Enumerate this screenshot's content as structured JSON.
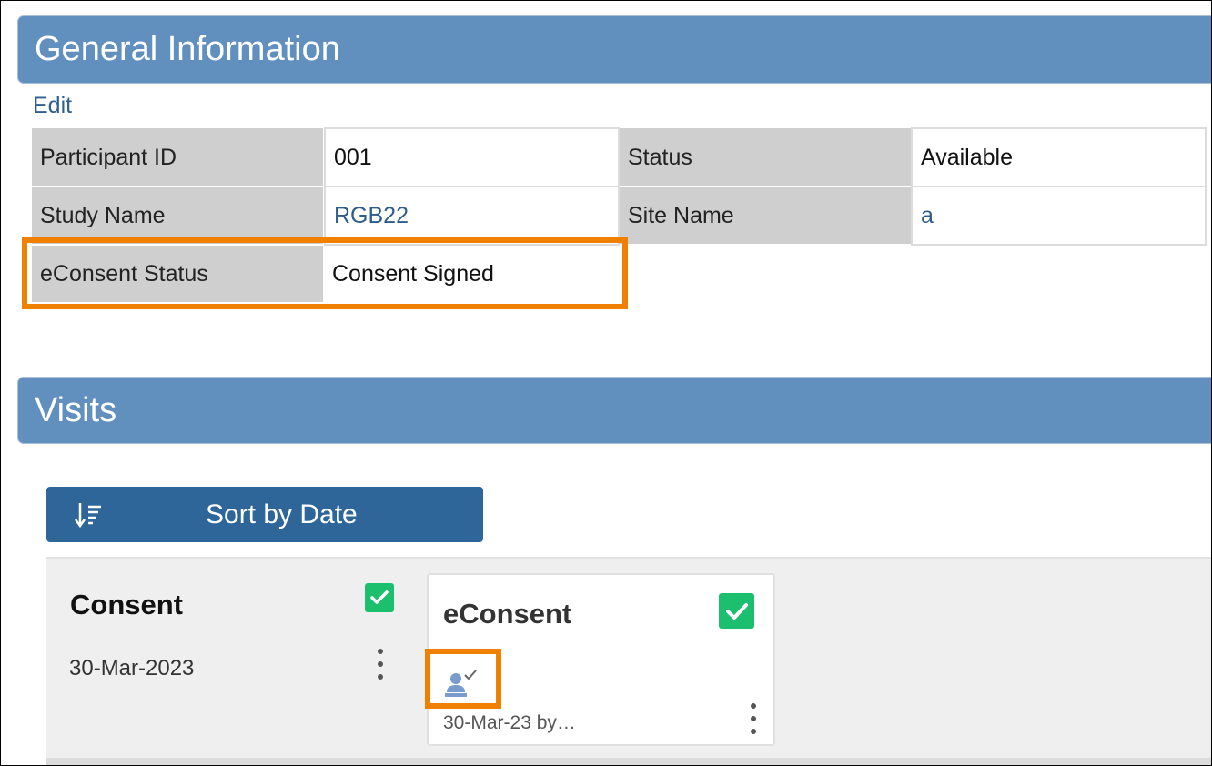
{
  "general_information": {
    "title": "General Information",
    "edit_label": "Edit",
    "rows": [
      {
        "label": "Participant ID",
        "value": "001"
      },
      {
        "label": "Status",
        "value": "Available"
      },
      {
        "label": "Study Name",
        "value": "RGB22"
      },
      {
        "label": "Site Name",
        "value": "a"
      },
      {
        "label": "eConsent Status",
        "value": "Consent Signed"
      }
    ]
  },
  "visits": {
    "title": "Visits",
    "sort_label": "Sort by Date",
    "sort_icon": "sort-descending-icon",
    "visit": {
      "title": "Consent",
      "date": "30-Mar-2023",
      "completed": true
    },
    "form_card": {
      "title": "eConsent",
      "meta": "30-Mar-23 by…",
      "completed": true,
      "status_icon": "signature-stamp-icon"
    }
  },
  "colors": {
    "header_bg": "#6190be",
    "button_bg": "#2f6699",
    "link": "#2e5d8c",
    "highlight": "#f08000",
    "check_green": "#1bbf6e"
  }
}
